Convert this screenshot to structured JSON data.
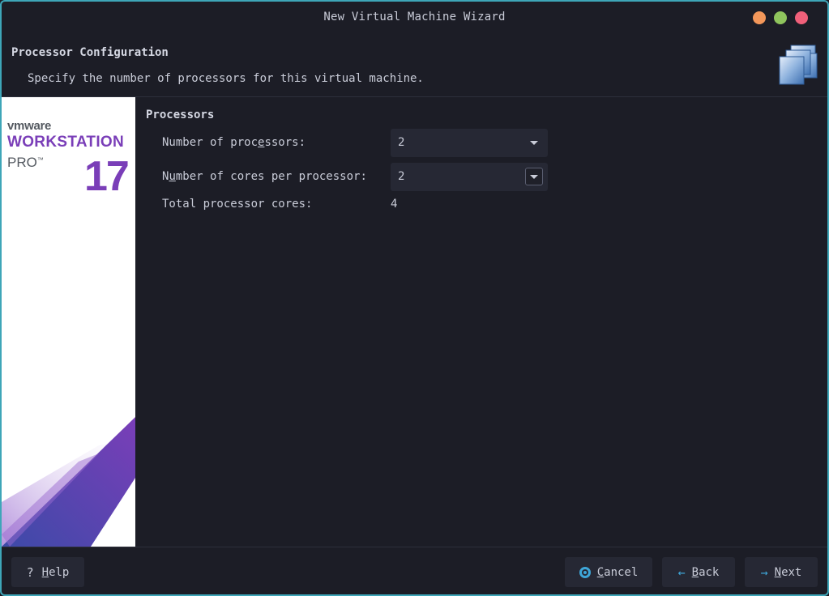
{
  "window": {
    "title": "New Virtual Machine Wizard"
  },
  "header": {
    "title": "Processor Configuration",
    "subtitle": "Specify the number of processors for this virtual machine.",
    "icon": "processors-icon"
  },
  "sidebar": {
    "brand_vendor": "vmware",
    "brand_product": "WORKSTATION",
    "brand_edition": "PRO",
    "brand_tm": "™",
    "brand_version": "17",
    "brand_color": "#7a3eb8"
  },
  "section": {
    "title": "Processors"
  },
  "fields": {
    "num_processors": {
      "label_pre": "Number of proc",
      "label_mnemonic": "e",
      "label_post": "ssors:",
      "value": "2"
    },
    "cores_per_processor": {
      "label_pre": "N",
      "label_mnemonic": "u",
      "label_post": "mber of cores per processor:",
      "value": "2"
    },
    "total_cores": {
      "label": "Total processor cores:",
      "value": "4"
    }
  },
  "footer": {
    "help": {
      "icon": "question-icon",
      "glyph": "?",
      "mnemonic": "H",
      "rest": "elp"
    },
    "cancel": {
      "icon": "cancel-icon",
      "mnemonic": "C",
      "rest": "ancel"
    },
    "back": {
      "icon": "arrow-left-icon",
      "glyph": "←",
      "mnemonic": "B",
      "rest": "ack"
    },
    "next": {
      "icon": "arrow-right-icon",
      "glyph": "→",
      "mnemonic": "N",
      "rest": "ext"
    }
  },
  "colors": {
    "accent": "#3ea6d8",
    "border": "#3ea6b8",
    "background": "#1c1d26"
  }
}
